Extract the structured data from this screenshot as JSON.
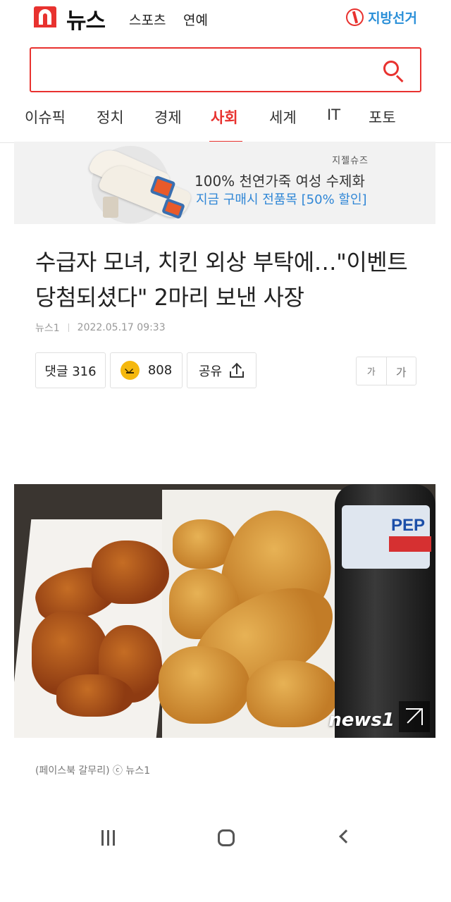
{
  "header": {
    "brand": "뉴스",
    "nav": [
      "스포츠",
      "연예"
    ],
    "election_label": "지방선거"
  },
  "search": {
    "placeholder": ""
  },
  "tabs": [
    {
      "label": "이슈픽",
      "active": false
    },
    {
      "label": "정치",
      "active": false
    },
    {
      "label": "경제",
      "active": false
    },
    {
      "label": "사회",
      "active": true
    },
    {
      "label": "세계",
      "active": false
    },
    {
      "label": "IT",
      "active": false
    },
    {
      "label": "포토",
      "active": false
    }
  ],
  "ad": {
    "brand": "지젤슈즈",
    "title": "100% 천연가죽 여성 수제화",
    "subtitle": "지금 구매시 전품목 [50% 할인]"
  },
  "article": {
    "headline": "수급자 모녀, 치킨 외상 부탁에…\"이벤트 당첨되셨다\" 2마리 보낸 사장",
    "source": "뉴스1",
    "datetime": "2022.05.17 09:33",
    "comment_label": "댓글 316",
    "like_count": "808",
    "share_label": "공유",
    "font_small": "가",
    "font_large": "가",
    "photo_watermark": "news1",
    "caption": "(페이스북 갈무리) ⓒ 뉴스1"
  },
  "colors": {
    "accent": "#e8322f",
    "election_blue": "#2a8fd8",
    "ad_blue": "#2f86d6"
  }
}
